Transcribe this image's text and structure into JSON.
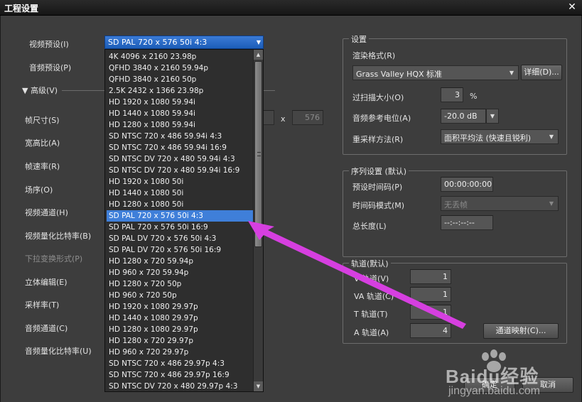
{
  "window": {
    "title": "工程设置",
    "close_icon": "close-icon"
  },
  "left": {
    "video_preset_label": "视频预设(I)",
    "audio_preset_label": "音频预设(P)",
    "advanced_label": "高级(V)",
    "frame_size_label": "帧尺寸(S)",
    "aspect_label": "宽高比(A)",
    "frame_rate_label": "帧速率(R)",
    "field_order_label": "场序(O)",
    "video_channel_label": "视频通道(H)",
    "video_quant_label": "视频量化比特率(B)",
    "pulldown_label": "下拉变换形式(P)",
    "stereo_label": "立体编辑(E)",
    "sample_rate_label": "采样率(T)",
    "audio_channel_label": "音频通道(C)",
    "audio_quant_label": "音频量化比特率(U)",
    "frame_x": "x",
    "frame_height": "576"
  },
  "preset": {
    "selected": "SD PAL 720 x 576 50i 4:3",
    "items": [
      "4K 4096 x 2160 23.98p",
      "QFHD 3840 x 2160 59.94p",
      "QFHD 3840 x 2160 50p",
      "2.5K 2432 x 1366 23.98p",
      "HD 1920 x 1080 59.94i",
      "HD 1440 x 1080 59.94i",
      "HD 1280 x 1080 59.94i",
      "SD NTSC 720 x 486 59.94i 4:3",
      "SD NTSC 720 x 486 59.94i 16:9",
      "SD NTSC DV 720 x 480 59.94i 4:3",
      "SD NTSC DV 720 x 480 59.94i 16:9",
      "HD 1920 x 1080 50i",
      "HD 1440 x 1080 50i",
      "HD 1280 x 1080 50i",
      "SD PAL 720 x 576 50i 4:3",
      "SD PAL 720 x 576 50i 16:9",
      "SD PAL DV 720 x 576 50i 4:3",
      "SD PAL DV 720 x 576 50i 16:9",
      "HD 1280 x 720 59.94p",
      "HD 960 x 720 59.94p",
      "HD 1280 x 720 50p",
      "HD 960 x 720 50p",
      "HD 1920 x 1080 29.97p",
      "HD 1440 x 1080 29.97p",
      "HD 1280 x 1080 29.97p",
      "HD 1280 x 720 29.97p",
      "HD 960 x 720 29.97p",
      "SD NTSC 720 x 486 29.97p 4:3",
      "SD NTSC 720 x 486 29.97p 16:9",
      "SD NTSC DV 720 x 480 29.97p 4:3"
    ],
    "selected_index": 14,
    "scroll_up_icon": "scroll-up-icon",
    "scroll_down_icon": "scroll-down-icon"
  },
  "settings": {
    "title": "设置",
    "render_format_label": "渲染格式(R)",
    "render_format_value": "Grass Valley HQX 标准",
    "detail_button": "详细(D)...",
    "overscan_label": "过扫描大小(O)",
    "overscan_value": "3",
    "overscan_unit": "%",
    "audio_ref_label": "音频参考电位(A)",
    "audio_ref_value": "-20.0 dB",
    "resample_label": "重采样方法(R)",
    "resample_value": "面积平均法 (快速且锐利)"
  },
  "sequence": {
    "title": "序列设置 (默认)",
    "timecode_label": "预设时间码(P)",
    "timecode_value": "00:00:00:00",
    "timecode_mode_label": "时间码模式(M)",
    "timecode_mode_value": "无丢帧",
    "length_label": "总长度(L)",
    "length_value": "--:--:--:--"
  },
  "tracks": {
    "title": "轨道(默认)",
    "v_label": "V 轨道(V)",
    "v_value": "1",
    "va_label": "VA 轨道(C)",
    "va_value": "1",
    "t_label": "T 轨道(T)",
    "t_value": "1",
    "a_label": "A 轨道(A)",
    "a_value": "4",
    "channel_map_button": "通道映射(C)..."
  },
  "footer": {
    "ok_button": "确定",
    "cancel_button": "取消"
  },
  "annotation": {
    "arrow_color": "#d63fe0"
  },
  "watermark": {
    "brand": "Baidu经验",
    "url": "jingyan.baidu.com"
  }
}
